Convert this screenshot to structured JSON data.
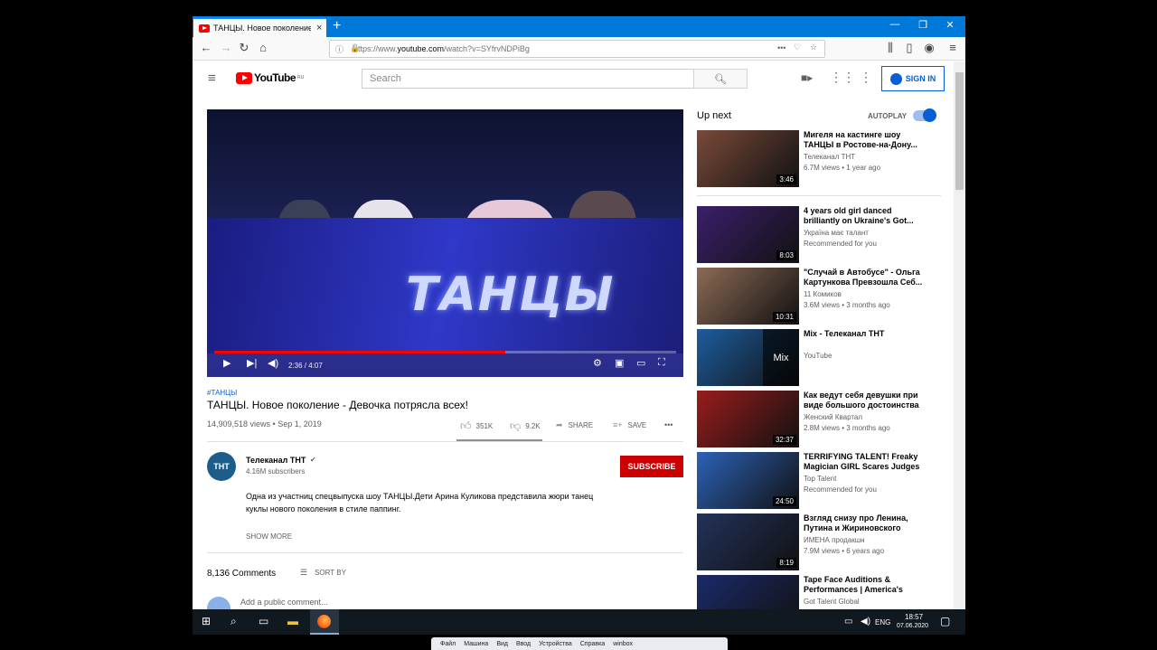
{
  "browser": {
    "tab_title": "ТАНЦЫ. Новое поколение - Д",
    "tab_close": "×",
    "new_tab": "+",
    "url_prefix": "https://www.",
    "url_domain": "youtube.com",
    "url_path": "/watch?v=SYfrvNDPiBg"
  },
  "header": {
    "logo_text": "YouTube",
    "logo_region": "RU",
    "search_placeholder": "Search",
    "sign_in": "SIGN IN"
  },
  "player": {
    "overlay_text": "ТАНЦЫ",
    "time": "2:36 / 4:07",
    "progress_fraction": 0.63
  },
  "video": {
    "hashtag": "#ТАНЦЫ",
    "title": "ТАНЦЫ. Новое поколение - Девочка потрясла всех!",
    "views_date": "14,909,518 views • Sep 1, 2019",
    "likes": "351K",
    "dislikes": "9.2K",
    "share": "SHARE",
    "save": "SAVE",
    "more": "•••"
  },
  "channel": {
    "avatar_text": "ТНТ",
    "name": "Телеканал ТНТ",
    "subscribers": "4.16M subscribers",
    "subscribe": "SUBSCRIBE",
    "description_line1": "Одна из участниц спецвыпуска шоу ТАНЦЫ.Дети Арина Куликова представила жюри танец",
    "description_line2": "куклы нового поколения в стиле паппинг.",
    "show_more": "SHOW MORE"
  },
  "comments": {
    "count": "8,136 Comments",
    "sort": "SORT BY",
    "placeholder": "Add a public comment..."
  },
  "sidebar": {
    "up_next": "Up next",
    "autoplay": "AUTOPLAY",
    "items": [
      {
        "title": "Мигеля на кастинге шоу ТАНЦЫ в Ростове-на-Дону...",
        "channel": "Телеканал ТНТ",
        "meta": "6.7M views • 1 year ago",
        "duration": "3:46",
        "color": "#7a4a3a"
      },
      {
        "title": "4 years old girl danced brilliantly on Ukraine's Got...",
        "channel": "Україна має талант",
        "meta": "Recommended for you",
        "duration": "8:03",
        "color": "#3b1f6b"
      },
      {
        "title": "\"Случай в Автобусе\" - Ольга Картункова Превзошла Себ...",
        "channel": "11 Комиков",
        "meta": "3.6M views • 3 months ago",
        "duration": "10:31",
        "color": "#8c6a55"
      },
      {
        "title": "Mix - Телеканал ТНТ",
        "channel": "YouTube",
        "meta": "",
        "duration": "",
        "color": "#1d5c9e"
      },
      {
        "title": "Как ведут себя девушки при виде большого достоинства ...",
        "channel": "Женский Квартал",
        "meta": "2.8M views • 3 months ago",
        "duration": "32:37",
        "color": "#9a1c1c"
      },
      {
        "title": "TERRIFYING TALENT! Freaky Magician GIRL Scares Judges ...",
        "channel": "Top Talent",
        "meta": "Recommended for you",
        "duration": "24:50",
        "color": "#2c62b8"
      },
      {
        "title": "Взгляд снизу про Ленина, Путина и Жириновского",
        "channel": "ИМЕНА продакшн",
        "meta": "7.9M views • 6 years ago",
        "duration": "8:19",
        "color": "#22325a"
      },
      {
        "title": "Tape Face Auditions & Performances | America's Got...",
        "channel": "Got Talent Global",
        "meta": "",
        "duration": "",
        "color": "#1a2a6a"
      }
    ],
    "mix_label": "Mix"
  },
  "taskbar": {
    "lang": "ENG",
    "time": "18:57",
    "date": "07.06.2020"
  },
  "vbox_menu": [
    "Файл",
    "Машина",
    "Вид",
    "Ввод",
    "Устройства",
    "Справка",
    "winbox"
  ]
}
